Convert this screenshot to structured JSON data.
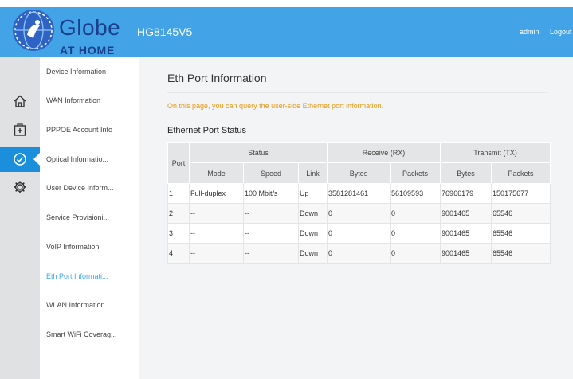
{
  "header": {
    "brand": "Globe",
    "brand_sub": "AT HOME",
    "model": "HG8145V5",
    "user": "admin",
    "logout": "Logout"
  },
  "iconbar": [
    "home-icon",
    "add-device-icon",
    "check-circle-icon",
    "gear-icon"
  ],
  "sidebar": {
    "items": [
      {
        "label": "Device Information"
      },
      {
        "label": "WAN Information"
      },
      {
        "label": "PPPOE Account Info"
      },
      {
        "label": "Optical Informatio..."
      },
      {
        "label": "User Device Inform..."
      },
      {
        "label": "Service Provisioni..."
      },
      {
        "label": "VoIP Information"
      },
      {
        "label": "Eth Port Informati..."
      },
      {
        "label": "WLAN Information"
      },
      {
        "label": "Smart WiFi Coverag..."
      }
    ]
  },
  "main": {
    "title": "Eth Port Information",
    "description": "On this page, you can query the user-side Ethernet port information.",
    "section_title": "Ethernet Port Status",
    "table": {
      "headers": {
        "port": "Port",
        "status": "Status",
        "receive": "Receive (RX)",
        "transmit": "Transmit (TX)",
        "mode": "Mode",
        "speed": "Speed",
        "link": "Link",
        "rx_bytes": "Bytes",
        "rx_packets": "Packets",
        "tx_bytes": "Bytes",
        "tx_packets": "Packets"
      },
      "rows": [
        {
          "port": "1",
          "mode": "Full-duplex",
          "speed": "100 Mbit/s",
          "link": "Up",
          "rx_bytes": "3581281461",
          "rx_packets": "56109593",
          "tx_bytes": "76966179",
          "tx_packets": "150175677"
        },
        {
          "port": "2",
          "mode": "--",
          "speed": "--",
          "link": "Down",
          "rx_bytes": "0",
          "rx_packets": "0",
          "tx_bytes": "9001465",
          "tx_packets": "65546"
        },
        {
          "port": "3",
          "mode": "--",
          "speed": "--",
          "link": "Down",
          "rx_bytes": "0",
          "rx_packets": "0",
          "tx_bytes": "9001465",
          "tx_packets": "65546"
        },
        {
          "port": "4",
          "mode": "--",
          "speed": "--",
          "link": "Down",
          "rx_bytes": "0",
          "rx_packets": "0",
          "tx_bytes": "9001465",
          "tx_packets": "65546"
        }
      ]
    }
  },
  "colors": {
    "header_bg": "#42a4e6",
    "brand": "#1b3f8c",
    "active_icon_bg": "#1b8fdb",
    "active_menu": "#41a7e8",
    "description": "#e59a14"
  }
}
